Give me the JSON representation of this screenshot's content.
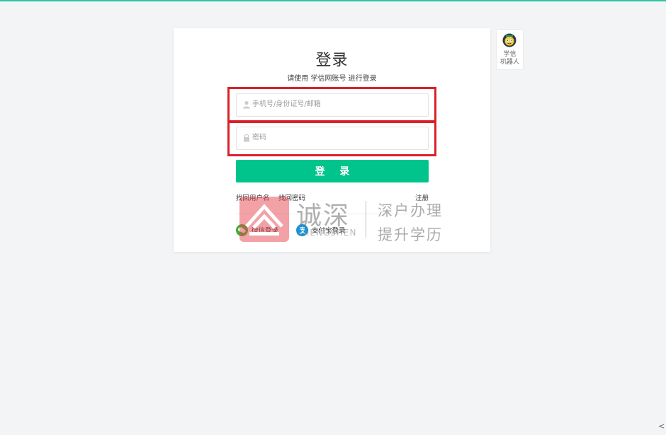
{
  "page": {
    "title": "登录",
    "subtitle": "请使用 学信网账号 进行登录"
  },
  "form": {
    "username_placeholder": "手机号/身份证号/邮箱",
    "username_value": "",
    "password_placeholder": "密码",
    "password_value": "",
    "login_button": "登 录"
  },
  "links": {
    "forgot_username": "找回用户名",
    "forgot_password": "找回密码",
    "register": "注册"
  },
  "social": {
    "wechat_label": "微信登录",
    "alipay_label": "支付宝登录"
  },
  "robot": {
    "label_line1": "学信",
    "label_line2": "机器人"
  },
  "watermark": {
    "brand_cn": "诚深",
    "brand_en": "CHENGSHEN",
    "line1": "深户办理",
    "line2": "提升学历"
  },
  "colors": {
    "accent": "#00c48c",
    "highlight": "#d9202b",
    "top_line": "#2fc4a0"
  },
  "misc": {
    "corner_glyph": "<"
  }
}
